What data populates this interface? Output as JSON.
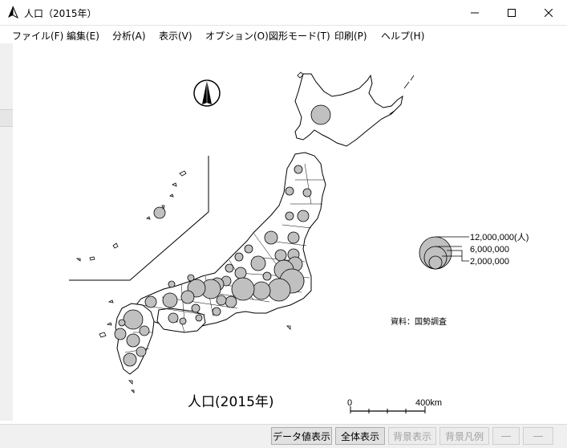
{
  "window": {
    "title": "人口（2015年）",
    "minimize_symbol": "—",
    "maximize_symbol": "☐",
    "close_symbol": "✕"
  },
  "menu": [
    {
      "label": "ファイル(F)"
    },
    {
      "label": "編集(E)"
    },
    {
      "label": "分析(A)"
    },
    {
      "label": "表示(V)"
    },
    {
      "label": "オプション(O)"
    },
    {
      "label": "図形モード(T)"
    },
    {
      "label": "印刷(P)"
    },
    {
      "label": "ヘルプ(H)"
    }
  ],
  "map": {
    "title": "人口(2015年)",
    "source": "資料：国勢調査",
    "legend": {
      "entries": [
        {
          "label": "12,000,000(人)",
          "value": 12000000
        },
        {
          "label": "6,000,000",
          "value": 6000000
        },
        {
          "label": "2,000,000",
          "value": 2000000
        }
      ]
    },
    "scale": {
      "start": "0",
      "end": "400km"
    },
    "north_arrow_icon": "north-arrow-icon",
    "symbol_color": "#c0c0c0"
  },
  "statusbar": {
    "buttons": [
      {
        "label": "データ値表示",
        "enabled": true
      },
      {
        "label": "全体表示",
        "enabled": true
      },
      {
        "label": "背景表示",
        "enabled": false
      },
      {
        "label": "背景凡例",
        "enabled": false
      },
      {
        "label": "―",
        "enabled": false
      },
      {
        "label": "―",
        "enabled": false
      }
    ]
  }
}
